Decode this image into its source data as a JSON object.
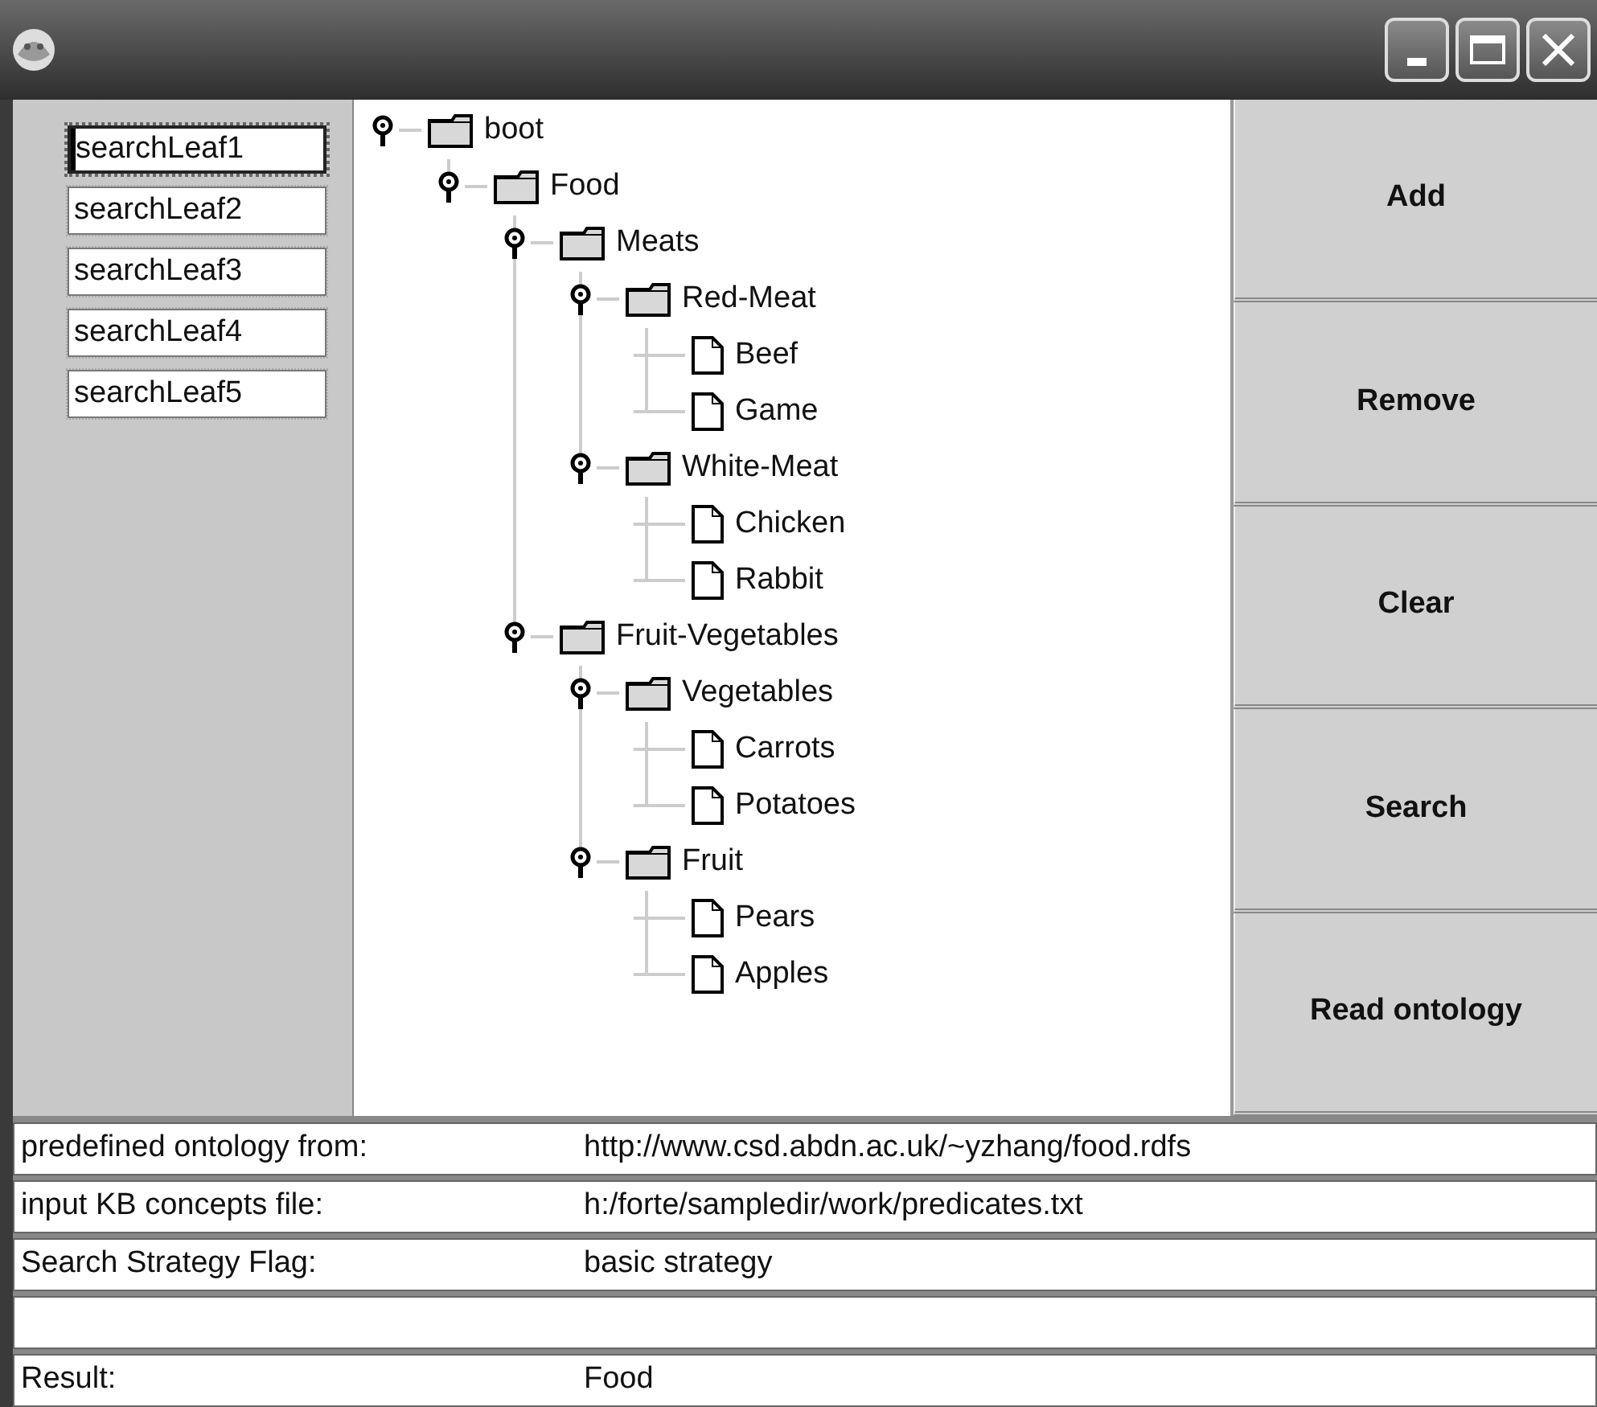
{
  "window": {
    "buttons": [
      {
        "kind": "minimize"
      },
      {
        "kind": "maximize"
      },
      {
        "kind": "close"
      }
    ]
  },
  "search_fields": [
    {
      "value": "searchLeaf1",
      "focused": true
    },
    {
      "value": "searchLeaf2",
      "focused": false
    },
    {
      "value": "searchLeaf3",
      "focused": false
    },
    {
      "value": "searchLeaf4",
      "focused": false
    },
    {
      "value": "searchLeaf5",
      "focused": false
    }
  ],
  "tree": [
    {
      "label": "boot",
      "expanded": true,
      "children": [
        {
          "label": "Food",
          "expanded": true,
          "children": [
            {
              "label": "Meats",
              "expanded": true,
              "children": [
                {
                  "label": "Red-Meat",
                  "expanded": true,
                  "children": [
                    {
                      "label": "Beef"
                    },
                    {
                      "label": "Game"
                    }
                  ]
                },
                {
                  "label": "White-Meat",
                  "expanded": true,
                  "children": [
                    {
                      "label": "Chicken"
                    },
                    {
                      "label": "Rabbit"
                    }
                  ]
                }
              ]
            },
            {
              "label": "Fruit-Vegetables",
              "expanded": true,
              "children": [
                {
                  "label": "Vegetables",
                  "expanded": true,
                  "children": [
                    {
                      "label": "Carrots"
                    },
                    {
                      "label": "Potatoes"
                    }
                  ]
                },
                {
                  "label": "Fruit",
                  "expanded": true,
                  "children": [
                    {
                      "label": "Pears"
                    },
                    {
                      "label": "Apples"
                    }
                  ]
                }
              ]
            }
          ]
        }
      ]
    }
  ],
  "buttons": [
    "Add",
    "Remove",
    "Clear",
    "Search",
    "Read ontology"
  ],
  "info_rows": [
    {
      "kind": "field",
      "label": "predefined ontology from:",
      "value": "http://www.csd.abdn.ac.uk/~yzhang/food.rdfs"
    },
    {
      "kind": "field",
      "label": "input KB concepts file:",
      "value": "h:/forte/sampledir/work/predicates.txt"
    },
    {
      "kind": "field",
      "label": "Search Strategy Flag:",
      "value": "basic strategy"
    },
    {
      "kind": "blank"
    },
    {
      "kind": "field",
      "label": "Result:",
      "value": "Food"
    }
  ]
}
